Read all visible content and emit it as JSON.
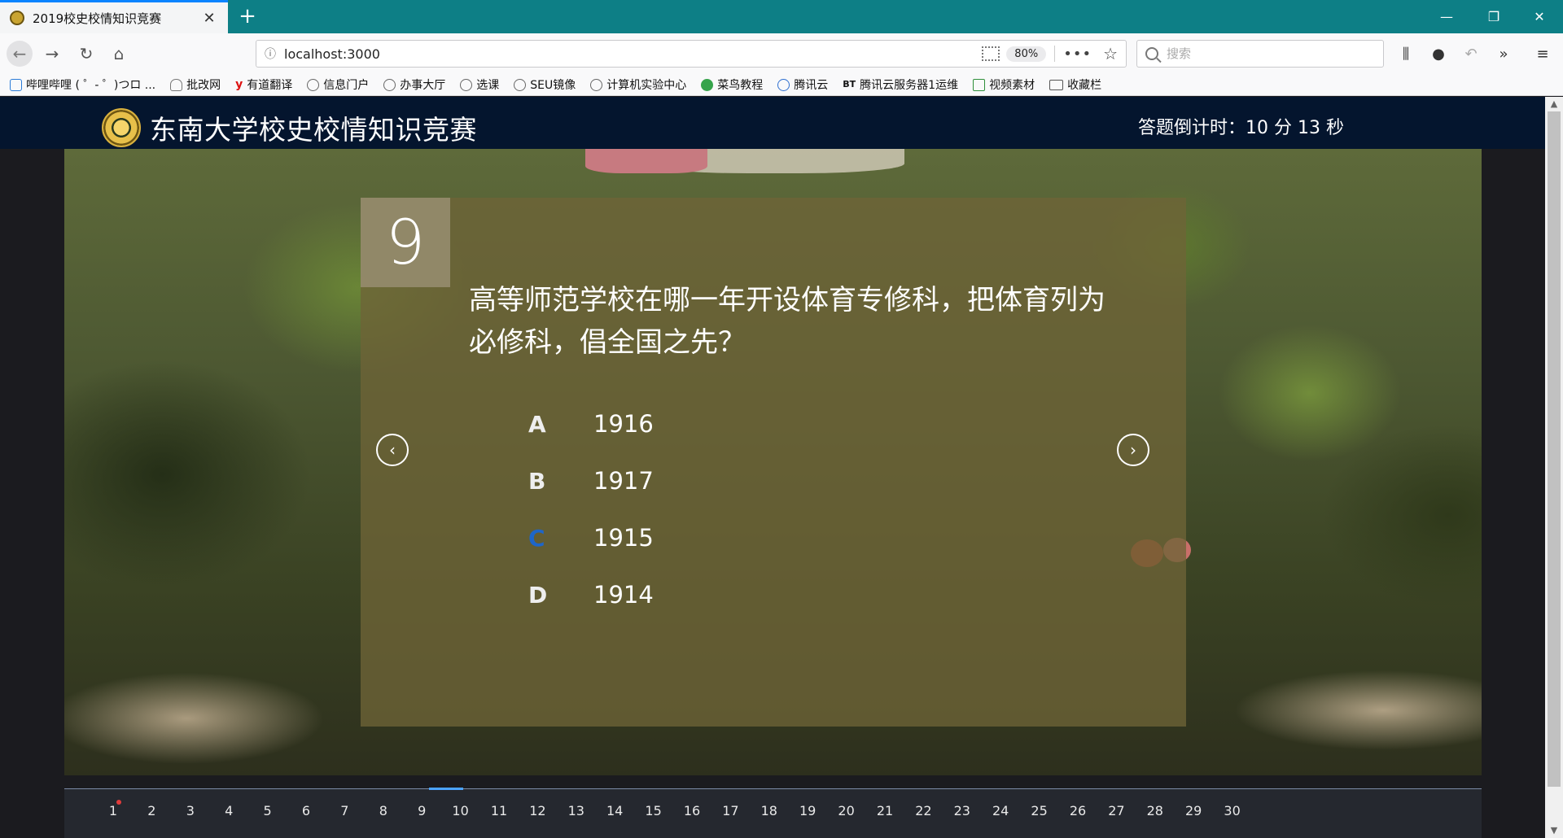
{
  "browser": {
    "tab_title": "2019校史校情知识竞赛",
    "tab_close": "✕",
    "new_tab": "+",
    "url": "localhost:3000",
    "zoom": "80%",
    "more": "•••",
    "search_placeholder": "搜索",
    "window": {
      "minimize": "—",
      "restore": "❐",
      "close": "✕"
    }
  },
  "bookmarks": [
    {
      "label": "哔哩哔哩 ( ゜- ゜)つロ ...",
      "icon": "tv"
    },
    {
      "label": "批改网",
      "icon": "cloud"
    },
    {
      "label": "有道翻译",
      "icon": "y"
    },
    {
      "label": "信息门户",
      "icon": "globe"
    },
    {
      "label": "办事大厅",
      "icon": "globe"
    },
    {
      "label": "选课",
      "icon": "globe"
    },
    {
      "label": "SEU镜像",
      "icon": "globe"
    },
    {
      "label": "计算机实验中心",
      "icon": "globe"
    },
    {
      "label": "菜鸟教程",
      "icon": "green"
    },
    {
      "label": "腾讯云",
      "icon": "blue"
    },
    {
      "label": "腾讯云服务器1运维",
      "icon": "bt"
    },
    {
      "label": "视频素材",
      "icon": "img"
    },
    {
      "label": "收藏栏",
      "icon": "folder"
    }
  ],
  "header": {
    "title": "东南大学校史校情知识竞赛",
    "countdown": "答题倒计时：10 分 13 秒"
  },
  "question": {
    "number": "9",
    "text": "高等师范学校在哪一年开设体育专修科，把体育列为必修科，倡全国之先？",
    "options": [
      {
        "letter": "A",
        "text": "1916"
      },
      {
        "letter": "B",
        "text": "1917"
      },
      {
        "letter": "C",
        "text": "1915"
      },
      {
        "letter": "D",
        "text": "1914"
      }
    ],
    "selected": "C"
  },
  "nav": {
    "prev": "‹",
    "next": "›"
  },
  "pager": {
    "pages": [
      "1",
      "2",
      "3",
      "4",
      "5",
      "6",
      "7",
      "8",
      "9",
      "10",
      "11",
      "12",
      "13",
      "14",
      "15",
      "16",
      "17",
      "18",
      "19",
      "20",
      "21",
      "22",
      "23",
      "24",
      "25",
      "26",
      "27",
      "28",
      "29",
      "30"
    ],
    "current": "9"
  },
  "colors": {
    "header_bg": "#04152e",
    "accent": "#4ba3ff",
    "selected_option": "#1e66c9",
    "tab_bar": "#0d7f86"
  }
}
